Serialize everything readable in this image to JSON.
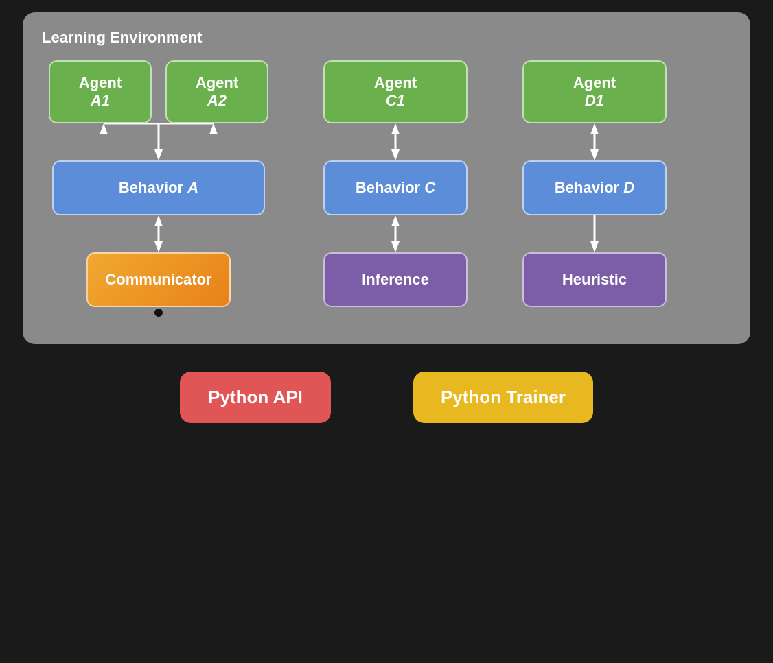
{
  "learning_env": {
    "title": "Learning Environment"
  },
  "agents": {
    "a1": "Agent A1",
    "a2": "Agent A2",
    "c1": "Agent C1",
    "d1": "Agent D1"
  },
  "behaviors": {
    "a": "Behavior A",
    "c": "Behavior C",
    "d": "Behavior D"
  },
  "communicator": "Communicator",
  "inference": "Inference",
  "heuristic": "Heuristic",
  "legend": {
    "python_api": "Python API",
    "python_trainer": "Python Trainer"
  }
}
